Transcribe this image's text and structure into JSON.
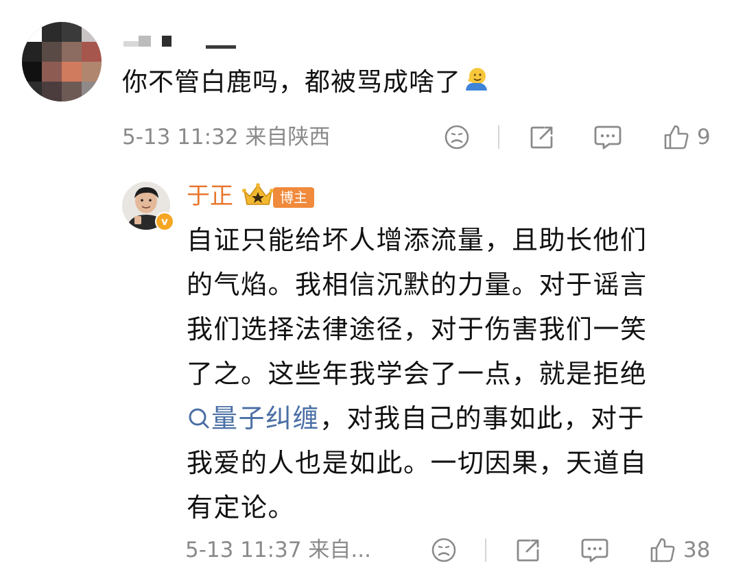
{
  "comment": {
    "text": "你不管白鹿吗，都被骂成啥了",
    "emoji": "salute-face-icon",
    "meta": "5-13 11:32 来自陕西",
    "like_count": "9"
  },
  "reply": {
    "author_name": "于正",
    "author_tag": "博主",
    "lines": [
      "自证只能给坏人增添流量，且助长他们",
      "的气焰。我相信沉默的力量。对于谣言",
      "我们选择法律途径，对于伤害我们一笑",
      "了之。这些年我学会了一点，就是拒绝"
    ],
    "topic_link": "量子纠缠",
    "line5_rest": "，对我自己的事如此，对于",
    "line6": "我爱的人也是如此。一切因果，天道自",
    "line7": "有定论。",
    "meta": "5-13 11:37 来自...",
    "like_count": "38"
  },
  "colors": {
    "author_name": "#e8772e",
    "author_tag_bg": "#f08a3c",
    "topic_link": "#4a6fa5",
    "meta_gray": "#8a8a8a"
  },
  "icons": {
    "dislike": "sad-face-icon",
    "share": "share-icon",
    "comment": "comment-icon",
    "like": "thumbs-up-icon",
    "crown": "crown-icon",
    "verified": "verified-badge-icon",
    "search": "search-icon"
  }
}
